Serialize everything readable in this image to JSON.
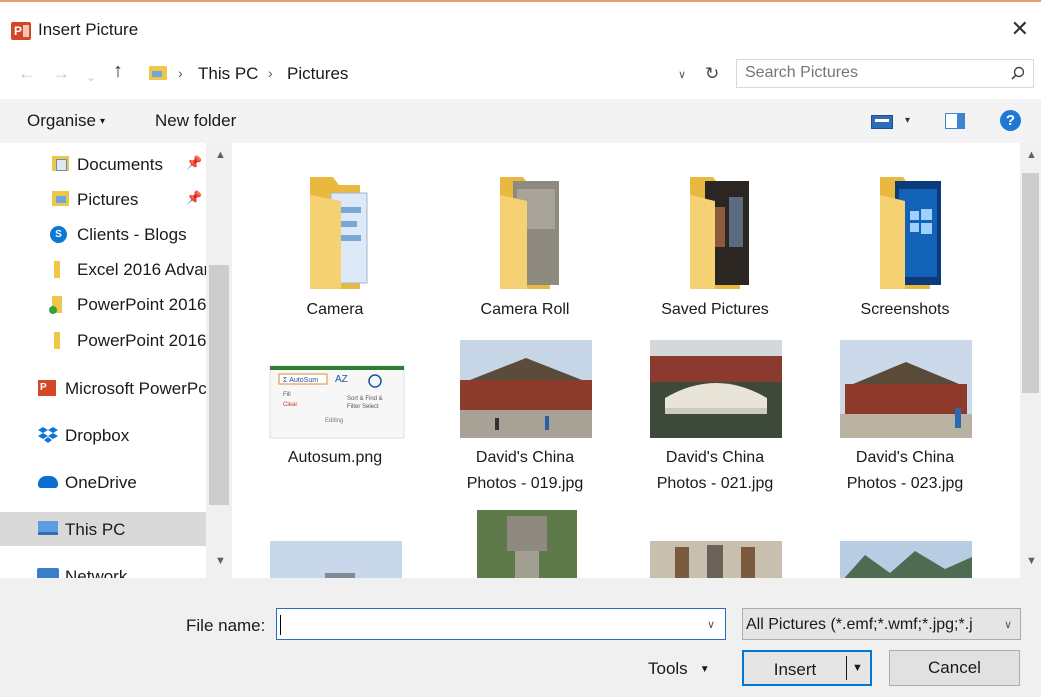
{
  "window": {
    "title": "Insert Picture",
    "close_glyph": "✕"
  },
  "address": {
    "crumbs": [
      "This PC",
      "Pictures"
    ],
    "search_placeholder": "Search Pictures"
  },
  "toolbar": {
    "organise_label": "Organise",
    "new_folder_label": "New folder",
    "help_glyph": "?"
  },
  "sidebar": {
    "items": [
      {
        "label": "Documents",
        "icon": "documents-folder-icon",
        "pinned": true
      },
      {
        "label": "Pictures",
        "icon": "pictures-folder-icon",
        "pinned": true
      },
      {
        "label": "Clients - Blogs",
        "icon": "sharepoint-icon"
      },
      {
        "label": "Excel 2016 Advar",
        "icon": "folder-icon"
      },
      {
        "label": "PowerPoint 2016",
        "icon": "folder-sync-icon"
      },
      {
        "label": "PowerPoint 2016",
        "icon": "folder-icon"
      },
      {
        "label": "Microsoft PowerPc",
        "icon": "powerpoint-icon"
      },
      {
        "label": "Dropbox",
        "icon": "dropbox-icon"
      },
      {
        "label": "OneDrive",
        "icon": "onedrive-cloud-icon"
      },
      {
        "label": "This PC",
        "icon": "computer-icon",
        "selected": true
      },
      {
        "label": "Network",
        "icon": "network-icon"
      }
    ]
  },
  "tiles": [
    {
      "label": "Camera",
      "kind": "folder"
    },
    {
      "label": "Camera Roll",
      "kind": "folder"
    },
    {
      "label": "Saved Pictures",
      "kind": "folder"
    },
    {
      "label": "Screenshots",
      "kind": "folder"
    },
    {
      "label": "Autosum.png",
      "kind": "image"
    },
    {
      "label": "David's China\nPhotos - 019.jpg",
      "line1": "David's China",
      "line2": "Photos - 019.jpg",
      "kind": "image"
    },
    {
      "line1": "David's China",
      "line2": "Photos - 021.jpg",
      "kind": "image"
    },
    {
      "line1": "David's China",
      "line2": "Photos - 023.jpg",
      "kind": "image"
    }
  ],
  "footer": {
    "file_name_label": "File name:",
    "file_name_value": "",
    "file_type": "All Pictures (*.emf;*.wmf;*.jpg;*.j",
    "tools_label": "Tools",
    "insert_label": "Insert",
    "cancel_label": "Cancel"
  },
  "colors": {
    "accent": "#0078d7",
    "folder": "#f0c64a",
    "powerpoint": "#d24726"
  }
}
